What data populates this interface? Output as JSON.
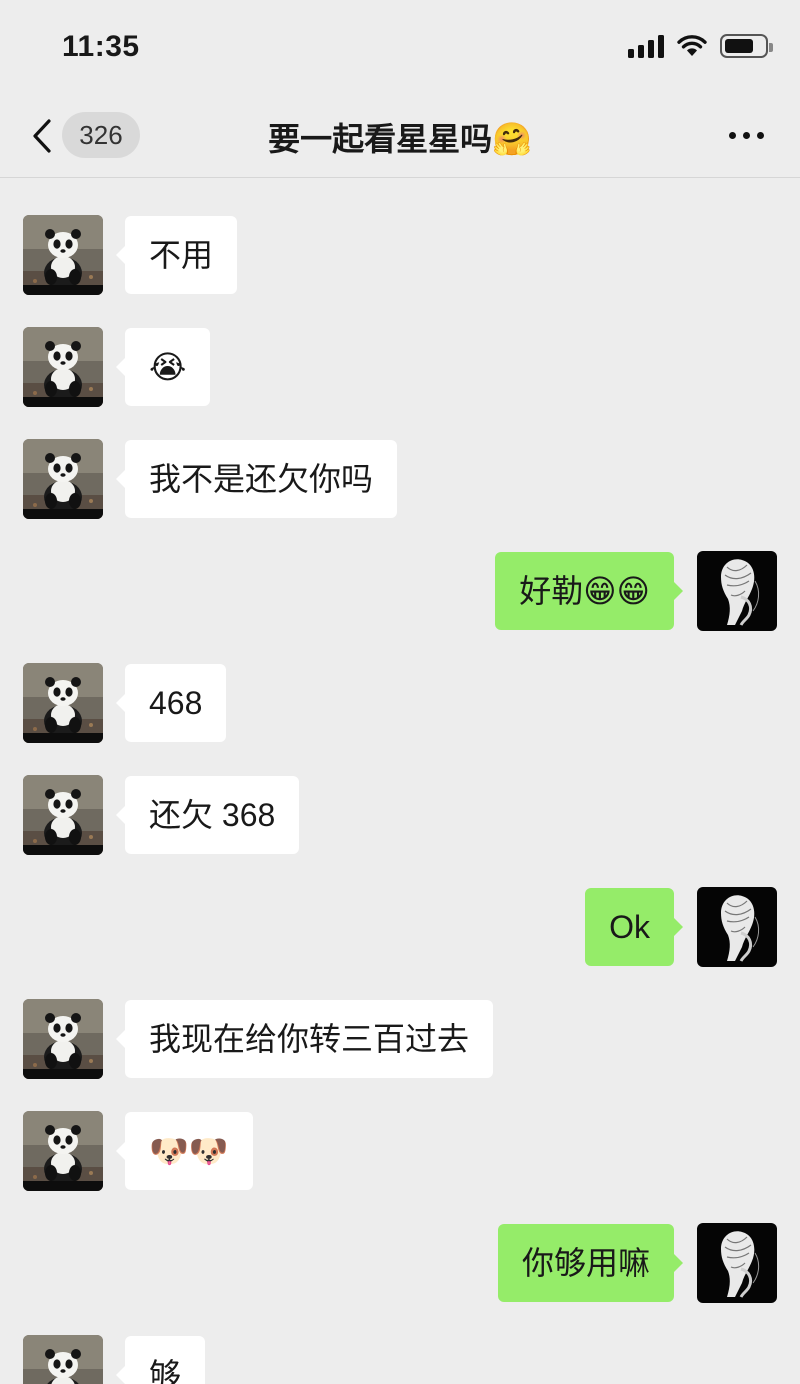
{
  "status_bar": {
    "time": "11:35",
    "icons": [
      "signal-icon",
      "wifi-icon",
      "battery-icon"
    ]
  },
  "nav": {
    "back_icon": "chevron-left-icon",
    "unread_count": "326",
    "title": "要一起看星星吗🤗",
    "more_icon": "more-dots-icon"
  },
  "colors": {
    "background": "#ededed",
    "incoming_bubble": "#ffffff",
    "outgoing_bubble": "#95ec69"
  },
  "messages": [
    {
      "side": "left",
      "avatar": "panda-avatar",
      "text": "不用"
    },
    {
      "side": "left",
      "avatar": "panda-avatar",
      "text": "😭"
    },
    {
      "side": "left",
      "avatar": "panda-avatar",
      "text": "我不是还欠你吗"
    },
    {
      "side": "right",
      "avatar": "sketch-portrait-avatar",
      "text": "好勒😁😁"
    },
    {
      "side": "left",
      "avatar": "panda-avatar",
      "text": "468"
    },
    {
      "side": "left",
      "avatar": "panda-avatar",
      "text": "还欠 368"
    },
    {
      "side": "right",
      "avatar": "sketch-portrait-avatar",
      "text": "Ok"
    },
    {
      "side": "left",
      "avatar": "panda-avatar",
      "text": "我现在给你转三百过去"
    },
    {
      "side": "left",
      "avatar": "panda-avatar",
      "text": "🐶🐶"
    },
    {
      "side": "right",
      "avatar": "sketch-portrait-avatar",
      "text": "你够用嘛"
    },
    {
      "side": "left",
      "avatar": "panda-avatar",
      "text": "够"
    }
  ]
}
